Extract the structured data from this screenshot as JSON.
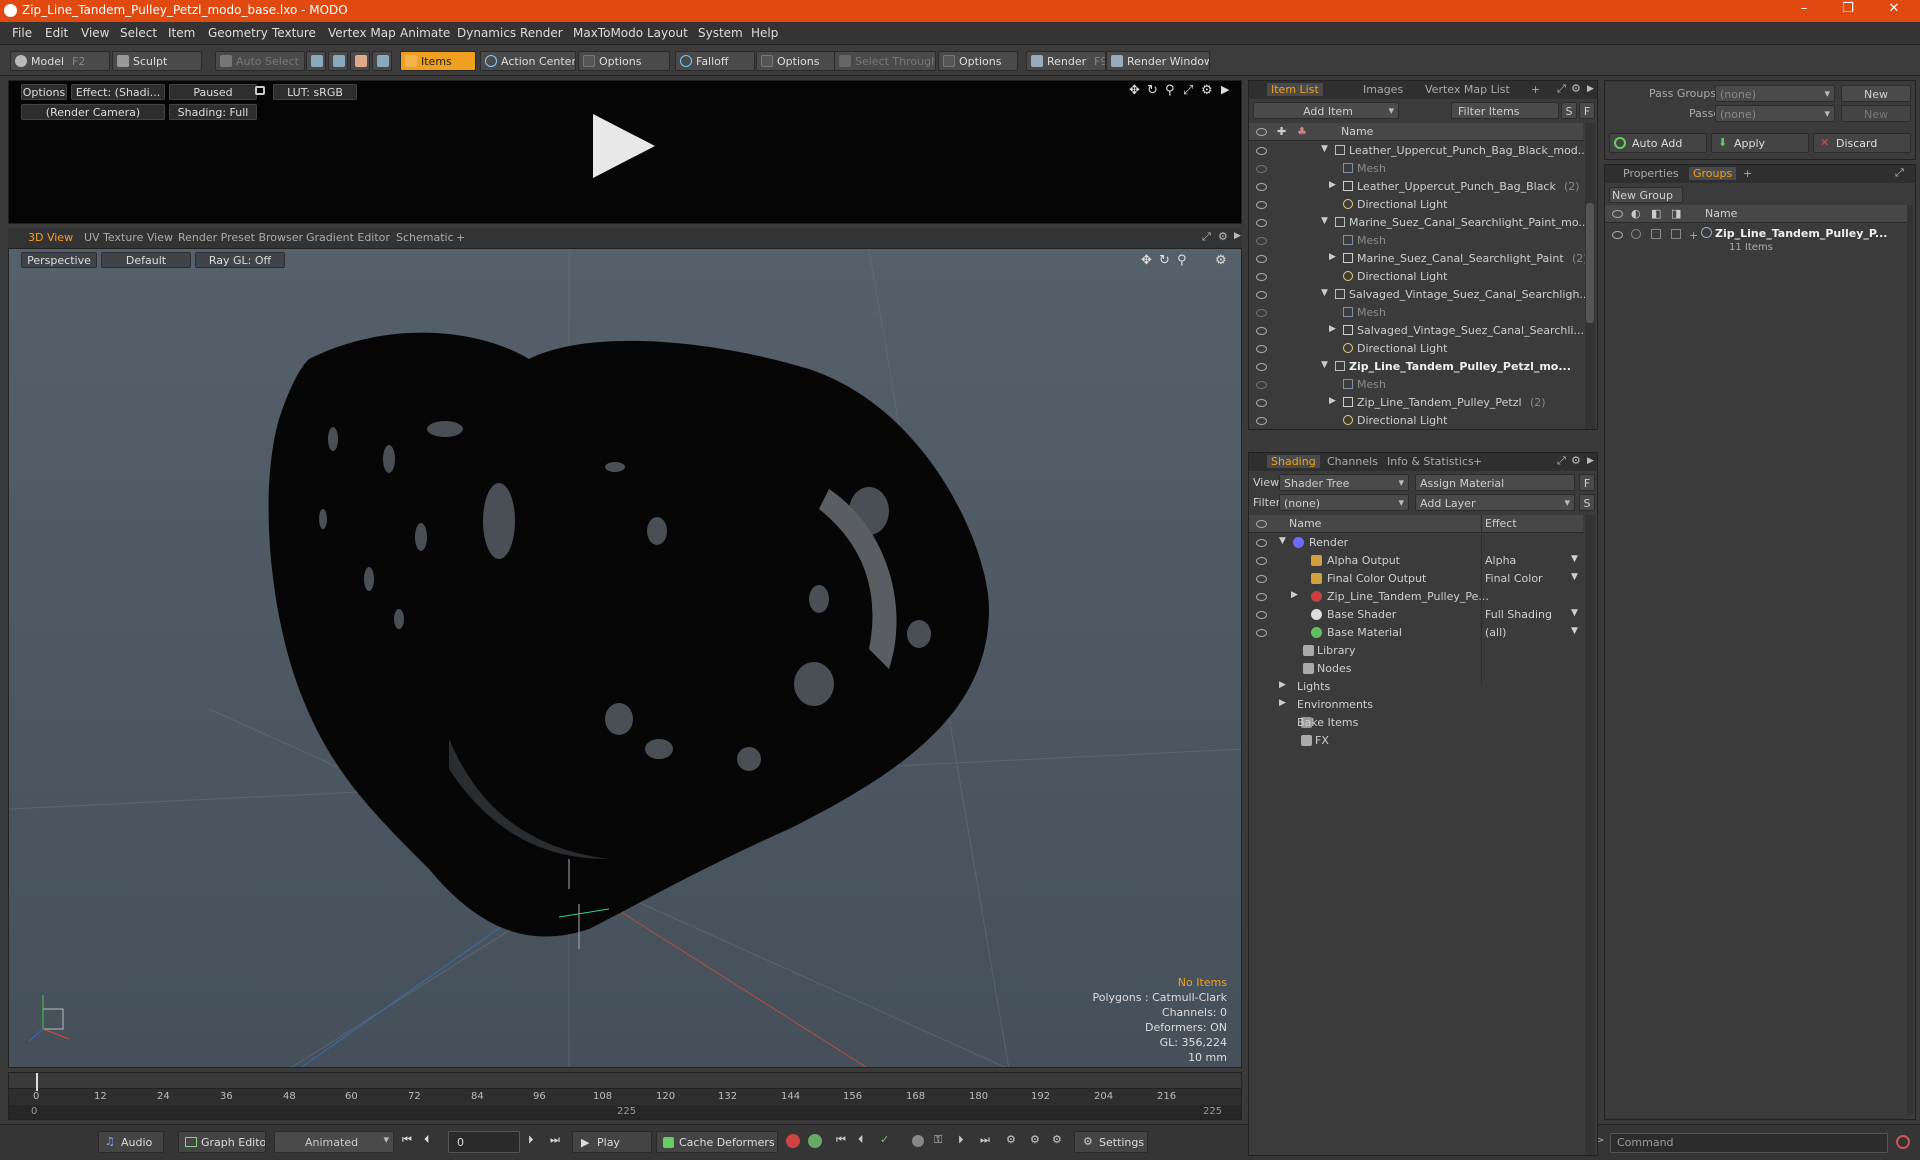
{
  "window": {
    "title": "Zip_Line_Tandem_Pulley_Petzl_modo_base.lxo - MODO",
    "minimize": "–",
    "maximize": "❐",
    "close": "✕"
  },
  "menu": [
    "File",
    "Edit",
    "View",
    "Select",
    "Item",
    "Geometry",
    "Texture",
    "Vertex Map",
    "Animate",
    "Dynamics",
    "Render",
    "MaxToModo",
    "Layout",
    "System",
    "Help"
  ],
  "toolbar": {
    "model": "Model",
    "model_key": "F2",
    "sculpt": "Sculpt",
    "auto_select": "Auto Select",
    "items": "Items",
    "action_center": "Action Center",
    "options1": "Options",
    "falloff": "Falloff",
    "options2": "Options",
    "select_through": "Select Through",
    "options3": "Options",
    "render": "Render",
    "render_key": "F9",
    "render_window": "Render Window"
  },
  "preview": {
    "options": "Options",
    "effect": "Effect: (Shadi...",
    "paused": "Paused",
    "lut": "LUT: sRGB",
    "camera": "(Render Camera)",
    "shading": "Shading: Full"
  },
  "viewport_tabs": [
    "3D View",
    "UV Texture View",
    "Render Preset Browser",
    "Gradient Editor",
    "Schematic",
    "+"
  ],
  "viewport": {
    "projection": "Perspective",
    "style": "Default",
    "raygl": "Ray GL: Off",
    "stats": {
      "no_items": "No Items",
      "polygons": "Polygons : Catmull-Clark",
      "channels": "Channels: 0",
      "deformers": "Deformers: ON",
      "gl": "GL: 356,224",
      "unit": "10 mm"
    }
  },
  "timeline": {
    "ticks": [
      "0",
      "12",
      "24",
      "36",
      "48",
      "60",
      "72",
      "84",
      "96",
      "108",
      "120",
      "132",
      "144",
      "156",
      "168",
      "180",
      "192",
      "204",
      "216"
    ],
    "start": "0",
    "mid": "225",
    "end": "225"
  },
  "bottombar": {
    "audio": "Audio",
    "graph_editor": "Graph Editor",
    "animated": "Animated",
    "frame": "0",
    "play": "Play",
    "cache_deformers": "Cache Deformers",
    "settings": "Settings"
  },
  "item_list": {
    "tabs": [
      "Item List",
      "Images",
      "Vertex Map List",
      "+"
    ],
    "add_item": "Add Item",
    "filter_items": "Filter Items",
    "s": "S",
    "f": "F",
    "col_name": "Name",
    "rows": [
      {
        "label": "Leather_Uppercut_Punch_Bag_Black_mod...",
        "level": 0,
        "kind": "scene",
        "bold": false,
        "count": ""
      },
      {
        "label": "Mesh",
        "level": 1,
        "kind": "mesh",
        "bold": false,
        "count": ""
      },
      {
        "label": "Leather_Uppercut_Punch_Bag_Black",
        "level": 1,
        "kind": "group",
        "bold": false,
        "count": "(2)"
      },
      {
        "label": "Directional Light",
        "level": 1,
        "kind": "light",
        "bold": false,
        "count": ""
      },
      {
        "label": "Marine_Suez_Canal_Searchlight_Paint_mo...",
        "level": 0,
        "kind": "scene",
        "bold": false,
        "count": ""
      },
      {
        "label": "Mesh",
        "level": 1,
        "kind": "mesh",
        "bold": false,
        "count": ""
      },
      {
        "label": "Marine_Suez_Canal_Searchlight_Paint",
        "level": 1,
        "kind": "group",
        "bold": false,
        "count": "(2)"
      },
      {
        "label": "Directional Light",
        "level": 1,
        "kind": "light",
        "bold": false,
        "count": ""
      },
      {
        "label": "Salvaged_Vintage_Suez_Canal_Searchligh...",
        "level": 0,
        "kind": "scene",
        "bold": false,
        "count": ""
      },
      {
        "label": "Mesh",
        "level": 1,
        "kind": "mesh",
        "bold": false,
        "count": ""
      },
      {
        "label": "Salvaged_Vintage_Suez_Canal_Searchli...",
        "level": 1,
        "kind": "group",
        "bold": false,
        "count": ""
      },
      {
        "label": "Directional Light",
        "level": 1,
        "kind": "light",
        "bold": false,
        "count": ""
      },
      {
        "label": "Zip_Line_Tandem_Pulley_Petzl_mo...",
        "level": 0,
        "kind": "scene",
        "bold": true,
        "count": ""
      },
      {
        "label": "Mesh",
        "level": 1,
        "kind": "mesh",
        "bold": false,
        "count": ""
      },
      {
        "label": "Zip_Line_Tandem_Pulley_Petzl",
        "level": 1,
        "kind": "group",
        "bold": false,
        "count": "(2)"
      },
      {
        "label": "Directional Light",
        "level": 1,
        "kind": "light",
        "bold": false,
        "count": ""
      }
    ]
  },
  "shading": {
    "tabs": [
      "Shading",
      "Channels",
      "Info & Statistics",
      "+"
    ],
    "view_label": "View",
    "view_value": "Shader Tree",
    "assign_material": "Assign Material",
    "f": "F",
    "filter_label": "Filter",
    "filter_value": "(none)",
    "add_layer": "Add Layer",
    "s": "S",
    "col_name": "Name",
    "col_effect": "Effect",
    "rows": [
      {
        "label": "Render",
        "effect": "",
        "level": 0
      },
      {
        "label": "Alpha Output",
        "effect": "Alpha",
        "level": 1
      },
      {
        "label": "Final Color Output",
        "effect": "Final Color",
        "level": 1
      },
      {
        "label": "Zip_Line_Tandem_Pulley_Pe...",
        "effect": "",
        "level": 1
      },
      {
        "label": "Base Shader",
        "effect": "Full Shading",
        "level": 1
      },
      {
        "label": "Base Material",
        "effect": "(all)",
        "level": 1
      },
      {
        "label": "Library",
        "effect": "",
        "level": 1
      },
      {
        "label": "Nodes",
        "effect": "",
        "level": 1
      },
      {
        "label": "Lights",
        "effect": "",
        "level": 0
      },
      {
        "label": "Environments",
        "effect": "",
        "level": 0
      },
      {
        "label": "Bake Items",
        "effect": "",
        "level": 0
      },
      {
        "label": "FX",
        "effect": "",
        "level": 0
      }
    ]
  },
  "groups": {
    "pass_groups_label": "Pass Groups",
    "pass_groups_value": "(none)",
    "new": "New",
    "passes_label": "Passes",
    "passes_value": "(none)",
    "new2": "New",
    "auto_add": "Auto Add",
    "apply": "Apply",
    "discard": "Discard",
    "tabs": [
      "Properties",
      "Groups",
      "+"
    ],
    "new_group": "New Group",
    "col_name": "Name",
    "item_name": "Zip_Line_Tandem_Pulley_P...",
    "item_count": "11 Items"
  },
  "command": {
    "placeholder": "Command"
  }
}
